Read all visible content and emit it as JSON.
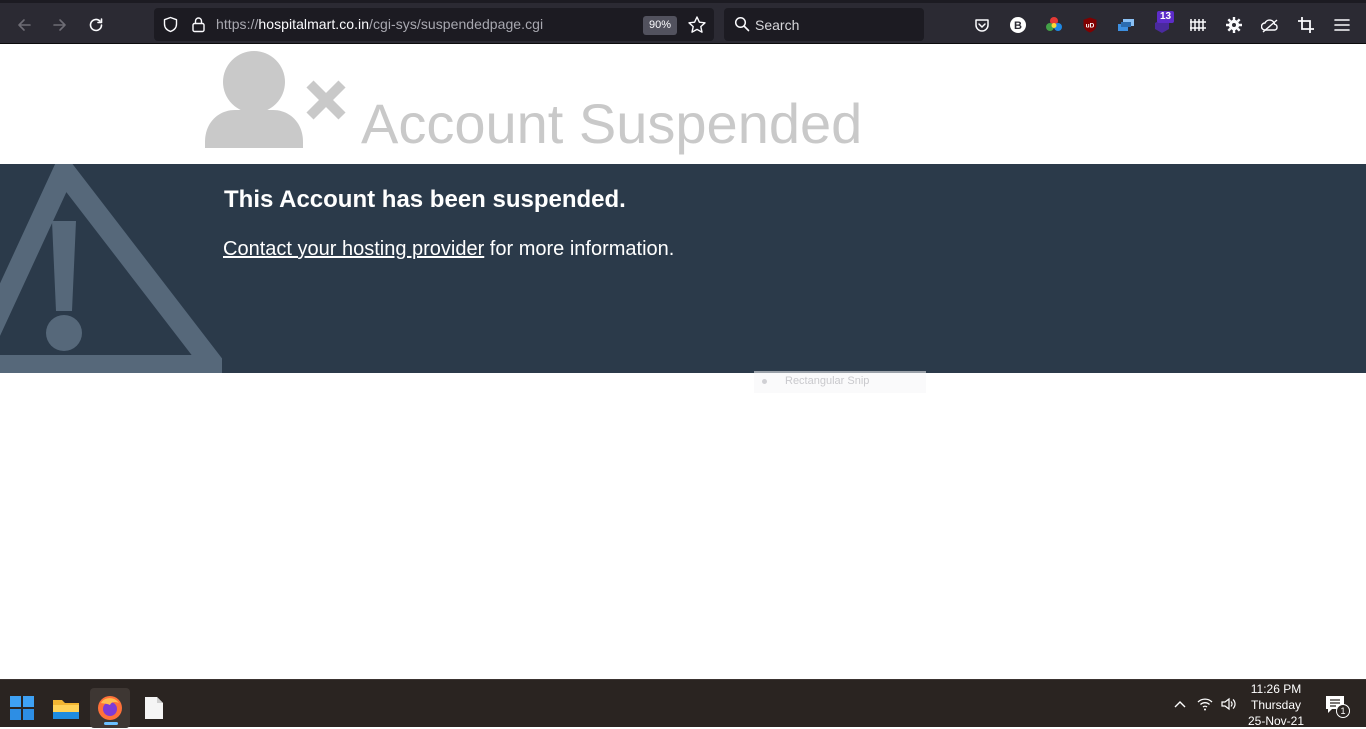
{
  "browser": {
    "url_host": "https://hospitalmart.co.in",
    "url_path": "/cgi-sys/suspendedpage.cgi",
    "zoom_level": "90%",
    "search_placeholder": "Search",
    "extension_badge": "13",
    "icons": [
      "back-icon",
      "forward-icon",
      "reload-icon",
      "shield-icon",
      "lock-icon",
      "star-icon",
      "search-icon",
      "pocket-icon",
      "bitwarden-icon",
      "color-picker-icon",
      "ublock-icon",
      "tab-manager-icon",
      "extension-badge-icon",
      "grid-icon",
      "gear-icon",
      "cloud-extension-icon",
      "crop-icon",
      "hamburger-menu-icon"
    ]
  },
  "page": {
    "heading": "Account Suspended",
    "message_title": "This Account has been suspended.",
    "contact_link": "Contact your hosting provider",
    "contact_suffix": " for more information.",
    "banner_color": "#2b3a4a",
    "overlay_label": "Rectangular Snip"
  },
  "taskbar": {
    "apps": [
      "windows-start-icon",
      "file-explorer-icon",
      "firefox-icon",
      "notepad-icon"
    ],
    "clock_time": "11:26 PM",
    "clock_day": "Thursday",
    "clock_date": "25-Nov-21",
    "notification_count": "1"
  }
}
